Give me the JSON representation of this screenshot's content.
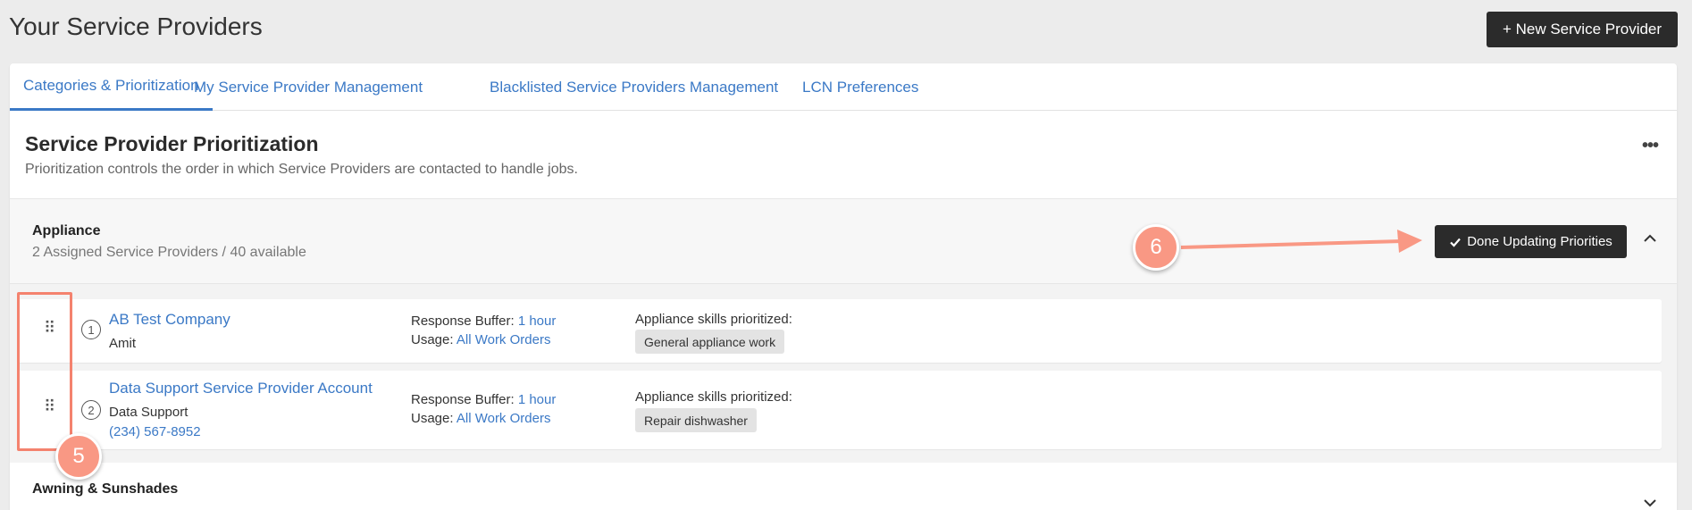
{
  "header": {
    "title": "Your Service Providers",
    "new_button": "+ New Service Provider"
  },
  "tabs": [
    {
      "label": "Categories & Prioritization",
      "active": true
    },
    {
      "label": "My Service Provider Management",
      "active": false
    },
    {
      "label": "Blacklisted Service Providers Management",
      "active": false
    },
    {
      "label": "LCN Preferences",
      "active": false
    }
  ],
  "section": {
    "title": "Service Provider Prioritization",
    "subtitle": "Prioritization controls the order in which Service Providers are contacted to handle jobs.",
    "more_icon": "ellipsis-icon"
  },
  "category": {
    "name": "Appliance",
    "count": "2 Assigned Service Providers / 40 available",
    "done_button": "Done Updating Priorities",
    "collapse_icon": "chevron-up-icon"
  },
  "providers": [
    {
      "rank": "1",
      "name": "AB Test Company",
      "contact": "Amit",
      "phone": "",
      "buffer_label": "Response Buffer:",
      "buffer_value": "1 hour",
      "usage_label": "Usage:",
      "usage_value": "All Work Orders",
      "skills_label": "Appliance skills prioritized:",
      "skill": "General appliance work"
    },
    {
      "rank": "2",
      "name": "Data Support Service Provider Account",
      "contact": "Data Support",
      "phone": "(234) 567-8952",
      "buffer_label": "Response Buffer:",
      "buffer_value": "1 hour",
      "usage_label": "Usage:",
      "usage_value": "All Work Orders",
      "skills_label": "Appliance skills prioritized:",
      "skill": "Repair dishwasher"
    }
  ],
  "next_category": {
    "name": "Awning & Sunshades",
    "expand_icon": "chevron-down-icon"
  },
  "annotations": {
    "drag_marker": "5",
    "done_marker": "6",
    "color": "#f4826e"
  },
  "colors": {
    "link": "#3b79c6",
    "dark_button": "#2b2b2b",
    "accent": "#f99884"
  }
}
